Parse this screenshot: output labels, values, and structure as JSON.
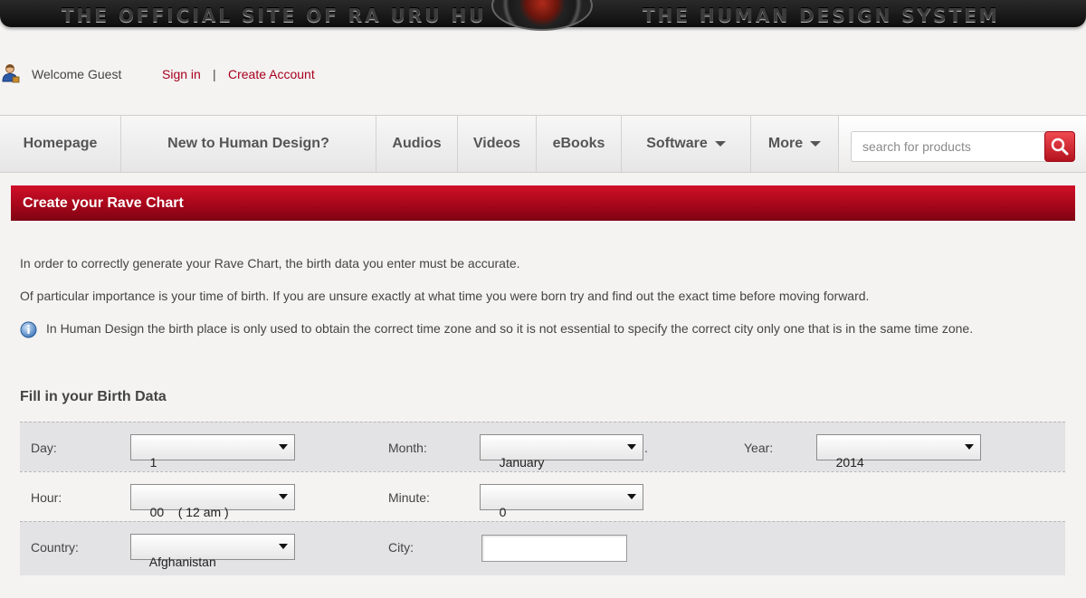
{
  "banner": {
    "left_text": "THE OFFICIAL SITE OF RA URU HU",
    "right_text": "THE HUMAN DESIGN SYSTEM"
  },
  "user": {
    "welcome": "Welcome Guest",
    "sign_in": "Sign in",
    "separator": "|",
    "create_account": "Create Account"
  },
  "nav": {
    "items": [
      {
        "label": "Homepage"
      },
      {
        "label": "New to Human Design?"
      },
      {
        "label": "Audios"
      },
      {
        "label": "Videos"
      },
      {
        "label": "eBooks"
      },
      {
        "label": "Software",
        "dropdown": true
      },
      {
        "label": "More",
        "dropdown": true
      }
    ],
    "search_placeholder": "search for products"
  },
  "section_title": "Create your Rave Chart",
  "intro": {
    "p1": "In order to correctly generate your Rave Chart, the birth data you enter must be accurate.",
    "p2": "Of particular importance is your time of birth. If you are unsure exactly at what time you were born try and find out the exact time before moving forward.",
    "p3": "In Human Design the birth place is only used to obtain the correct time zone and so it is not essential to specify the correct city only one that is in the same time zone."
  },
  "form": {
    "title": "Fill in your Birth Data",
    "day_label": "Day:",
    "day_value": "1",
    "month_label": "Month:",
    "month_value": "January",
    "month_suffix": ".",
    "year_label": "Year:",
    "year_value": "2014",
    "hour_label": "Hour:",
    "hour_value": "00    ( 12 am )",
    "minute_label": "Minute:",
    "minute_value": "0",
    "country_label": "Country:",
    "country_value": "Afghanistan",
    "city_label": "City:",
    "city_value": ""
  },
  "colors": {
    "accent_red": "#a8001e",
    "header_bar": "#a7071b",
    "search_button": "#d92a36"
  },
  "icons": {
    "user": "user-icon",
    "search": "search-icon",
    "info": "info-icon",
    "dropdown": "chevron-down-icon"
  }
}
